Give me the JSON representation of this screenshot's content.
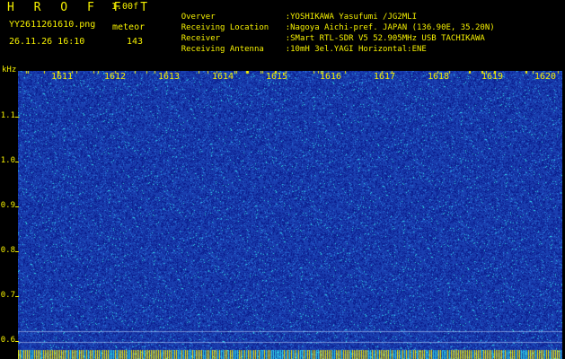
{
  "header": {
    "app_title": "H R O F F T",
    "version": "1.00f",
    "filename": "YY2611261610.png",
    "mode": "meteor",
    "datetime": "26.11.26 16:10",
    "count": "143"
  },
  "info": [
    {
      "label": "Overver",
      "value": ":YOSHIKAWA Yasufumi /JG2MLI"
    },
    {
      "label": "Receiving Location",
      "value": ":Nagoya Aichi-pref. JAPAN (136.90E, 35.20N)"
    },
    {
      "label": "Receiver",
      "value": ":SMart RTL-SDR V5 52.905MHz USB TACHIKAWA"
    },
    {
      "label": "Receiving Antenna",
      "value": ":10mH 3el.YAGI Horizontal:ENE"
    }
  ],
  "spectrogram": {
    "unit_label": "kHz",
    "y_ticks": [
      "1.1",
      "1.0",
      "0.9",
      "0.8",
      "0.7",
      "0.6"
    ],
    "x_ticks": [
      "1611",
      "1612",
      "1613",
      "1614",
      "1615",
      "1616",
      "1617",
      "1618",
      "1619",
      "1620"
    ],
    "colors": {
      "background": "#1a3fb0",
      "noise_low": "#0a1c8c",
      "noise_mid": "#2a7fe0",
      "noise_high": "#30e0e8",
      "hot": "#f5f000",
      "text": "#f5f000"
    }
  }
}
